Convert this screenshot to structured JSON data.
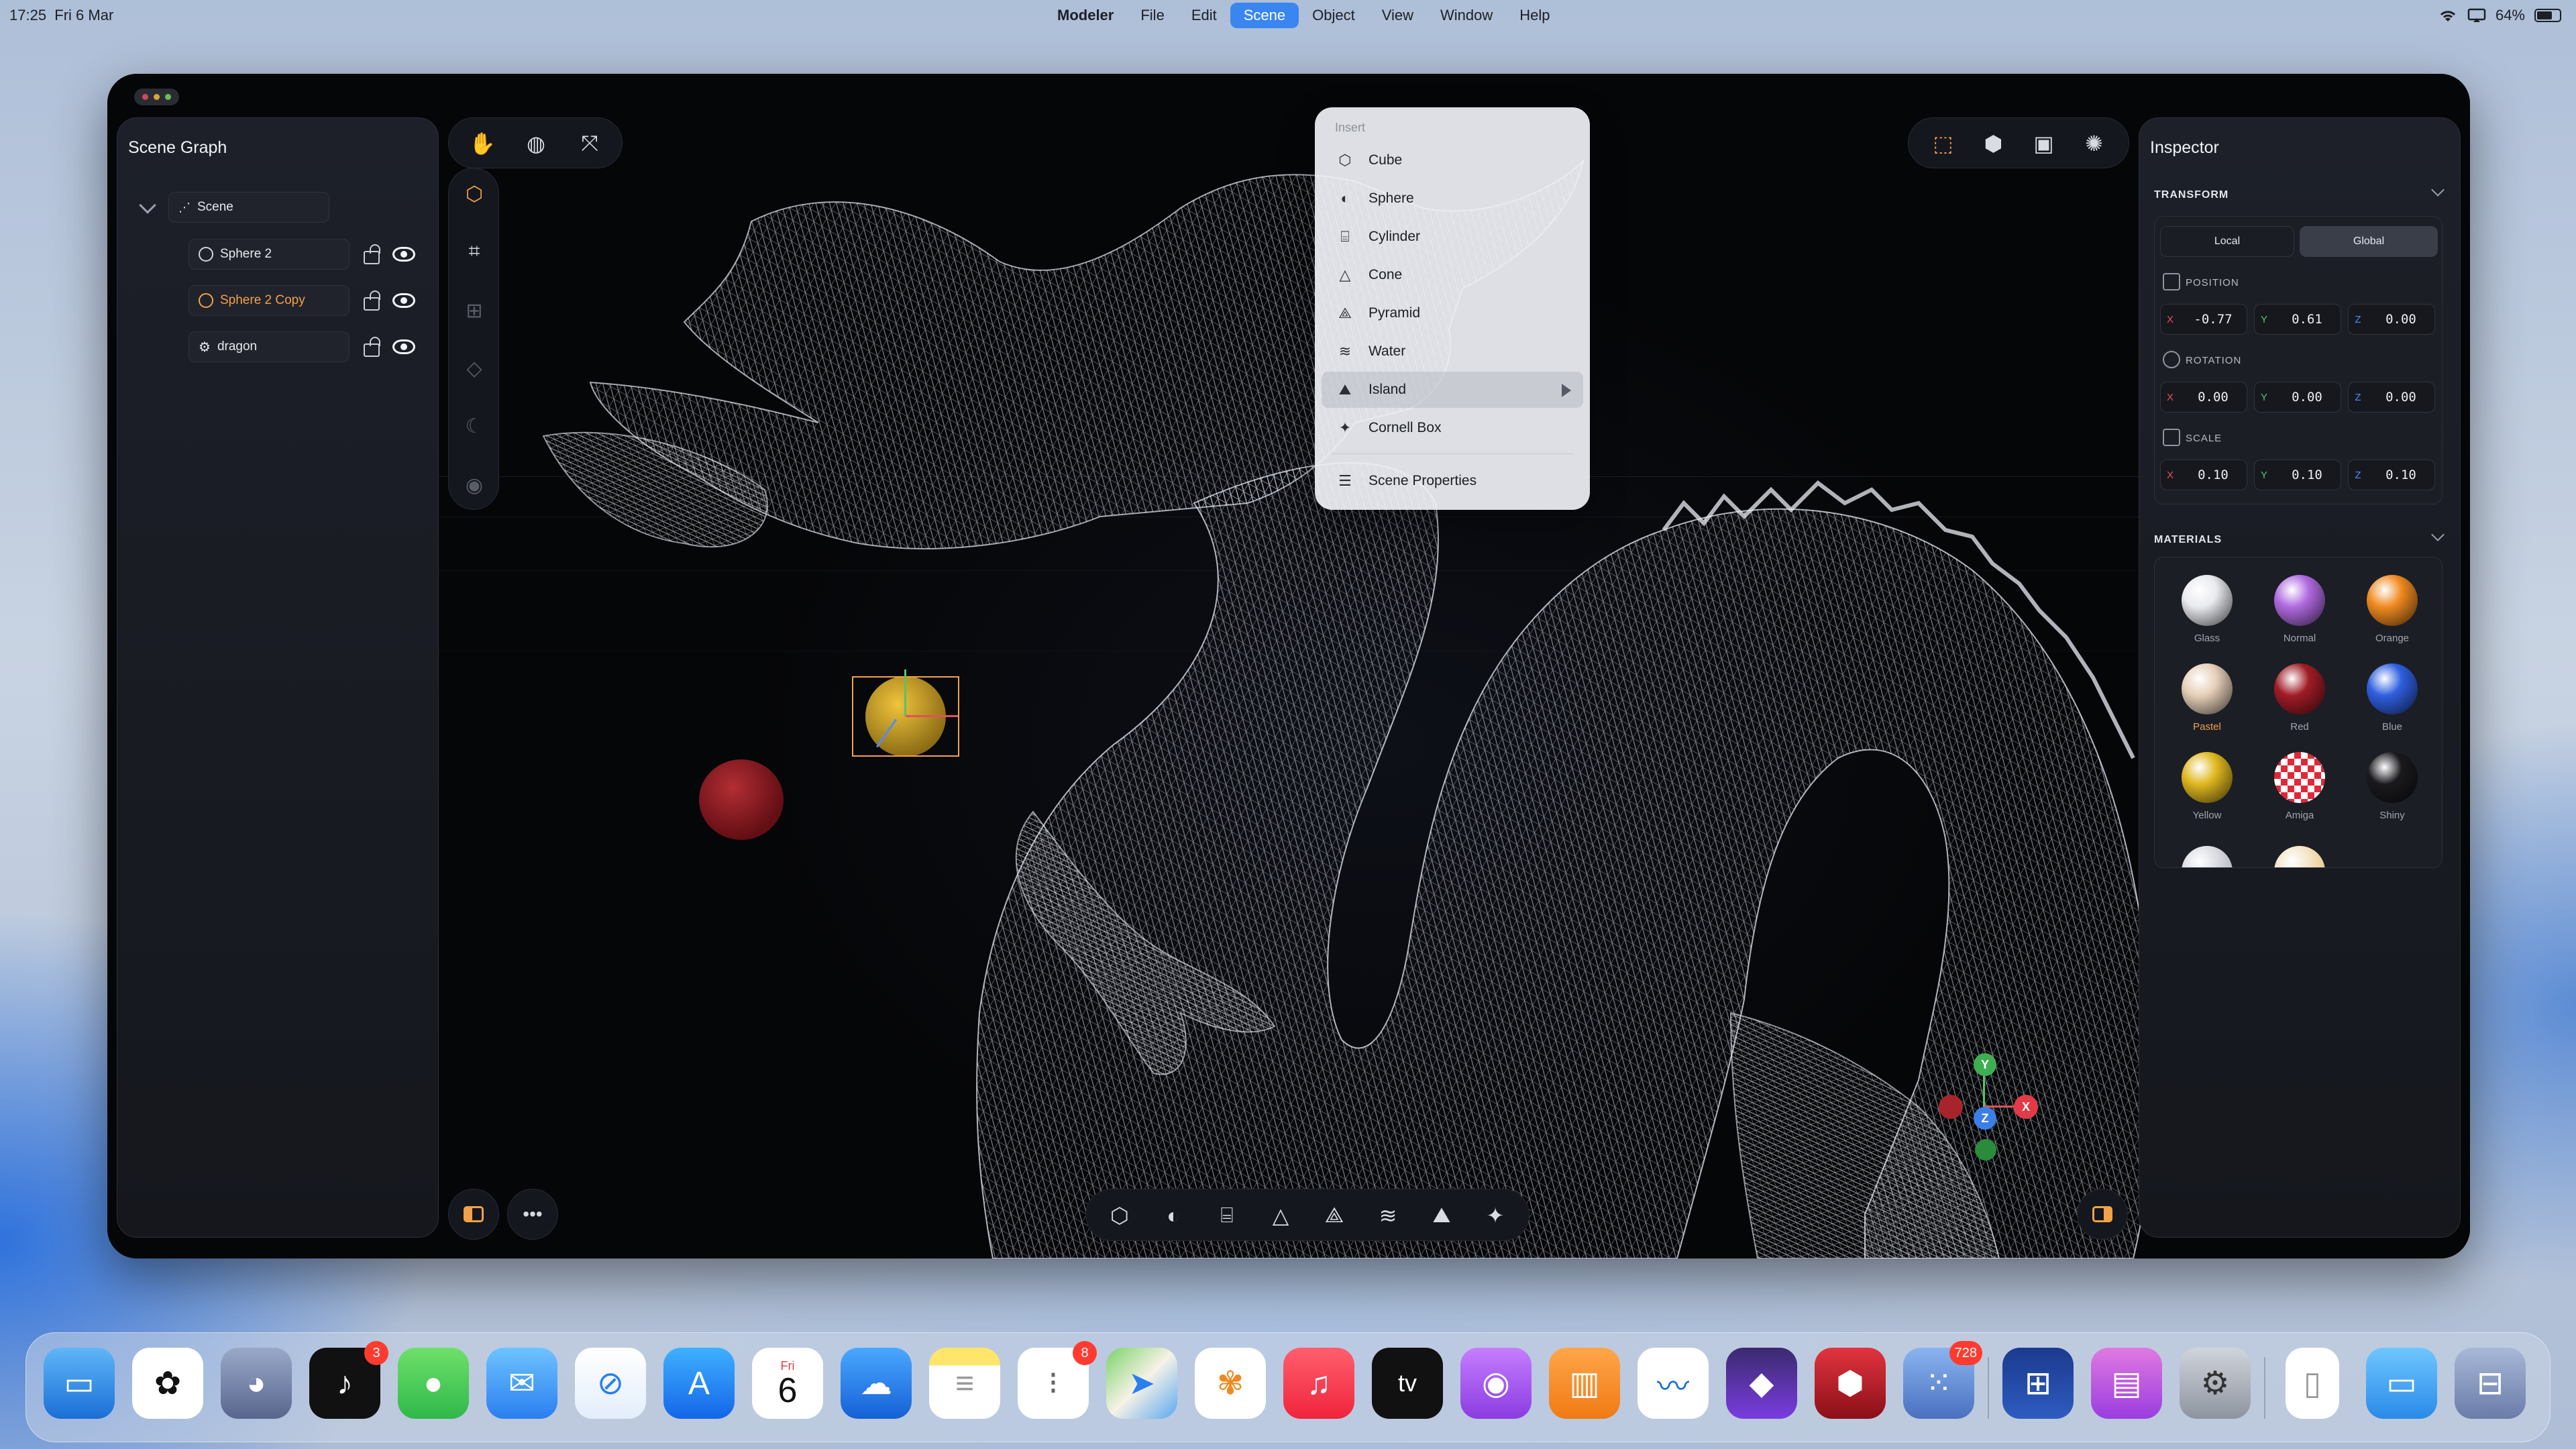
{
  "menubar": {
    "time": "17:25",
    "date": "Fri 6 Mar",
    "app_name": "Modeler",
    "menus": [
      "File",
      "Edit",
      "Scene",
      "Object",
      "View",
      "Window",
      "Help"
    ],
    "active_menu": "Scene",
    "battery": "64%"
  },
  "scene_graph": {
    "title": "Scene Graph",
    "root": "Scene",
    "nodes": [
      {
        "name": "Sphere 2",
        "selected": false
      },
      {
        "name": "Sphere 2 Copy",
        "selected": true
      },
      {
        "name": "dragon",
        "selected": false
      }
    ]
  },
  "scene_menu": {
    "header": "Insert",
    "items": [
      "Cube",
      "Sphere",
      "Cylinder",
      "Cone",
      "Pyramid",
      "Water",
      "Island",
      "Cornell Box"
    ],
    "highlighted": "Island",
    "footer_item": "Scene Properties"
  },
  "inspector": {
    "title": "Inspector",
    "transform": {
      "heading": "TRANSFORM",
      "local_label": "Local",
      "global_label": "Global",
      "position_label": "POSITION",
      "rotation_label": "ROTATION",
      "scale_label": "SCALE",
      "position": {
        "x": "-0.77",
        "y": "0.61",
        "z": "0.00"
      },
      "rotation": {
        "x": "0.00",
        "y": "0.00",
        "z": "0.00"
      },
      "scale": {
        "x": "0.10",
        "y": "0.10",
        "z": "0.10"
      },
      "axis_labels": {
        "x": "X",
        "y": "Y",
        "z": "Z"
      }
    },
    "materials": {
      "heading": "MATERIALS",
      "items": [
        {
          "name": "Glass",
          "color": "#e9eaee"
        },
        {
          "name": "Normal",
          "color": "#b06ae0"
        },
        {
          "name": "Orange",
          "color": "#f08a20"
        },
        {
          "name": "Pastel",
          "color": "#e6cfb8"
        },
        {
          "name": "Red",
          "color": "#a01c26"
        },
        {
          "name": "Blue",
          "color": "#2f5fe0"
        },
        {
          "name": "Yellow",
          "color": "#e0b820"
        },
        {
          "name": "Amiga",
          "color": "#e02838"
        },
        {
          "name": "Shiny",
          "color": "#1a1a1e"
        }
      ],
      "selected": "Pastel"
    }
  },
  "gizmo": {
    "x": "X",
    "y": "Y",
    "z": "Z"
  },
  "dock": {
    "calendar_day": "Fri",
    "calendar_date": "6",
    "badges": {
      "tiktok": "3",
      "reminders": "8",
      "launchpad": "728"
    }
  },
  "colors": {
    "accent_orange": "#f3a14a",
    "menu_highlight": "#3a86f0",
    "axis_x": "#e1525c",
    "axis_y": "#55c46a",
    "axis_z": "#4d8ff0"
  }
}
